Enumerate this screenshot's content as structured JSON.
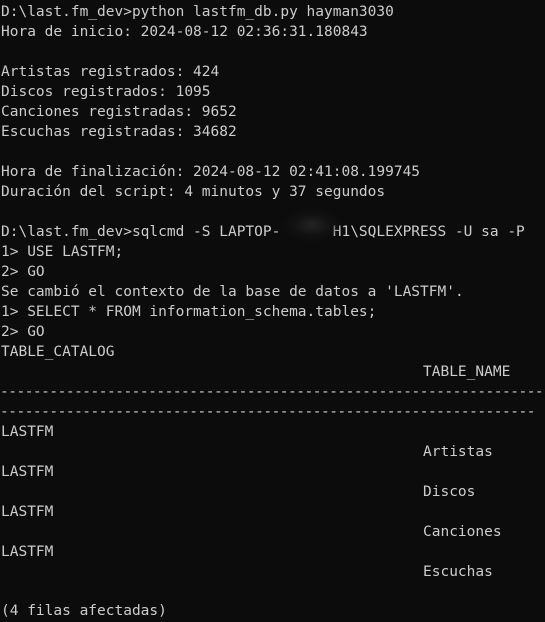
{
  "terminal": {
    "colors": {
      "background": "#0c0c0c",
      "foreground": "#cccccc"
    },
    "lines": [
      "D:\\last.fm_dev>python lastfm_db.py hayman3030",
      "Hora de inicio: 2024-08-12 02:36:31.180843",
      "Artistas registrados: 424",
      "Discos registrados: 1095",
      "Canciones registradas: 9652",
      "Escuchas registradas: 34682",
      "Hora de finalización: 2024-08-12 02:41:08.199745",
      "Duración del script: 4 minutos y 37 segundos",
      "D:\\last.fm_dev>sqlcmd -S LAPTOP-      H1\\SQLEXPRESS -U sa -P",
      "1> USE LASTFM;",
      "2> GO",
      "Se cambió el contexto de la base de datos a 'LASTFM'.",
      "1> SELECT * FROM information_schema.tables;",
      "2> GO",
      "TABLE_CATALOG"
    ],
    "table": {
      "header_col2": "TABLE_NAME",
      "separator_long": "----------------------------------------------------------------------------------------------------",
      "separator_short": "----------------------------------------------------------------- -------------------",
      "rows": [
        {
          "catalog": "LASTFM",
          "name": "Artistas"
        },
        {
          "catalog": "LASTFM",
          "name": "Discos"
        },
        {
          "catalog": "LASTFM",
          "name": "Canciones"
        },
        {
          "catalog": "LASTFM",
          "name": "Escuchas"
        }
      ],
      "footer": "(4 filas afectadas)"
    }
  }
}
